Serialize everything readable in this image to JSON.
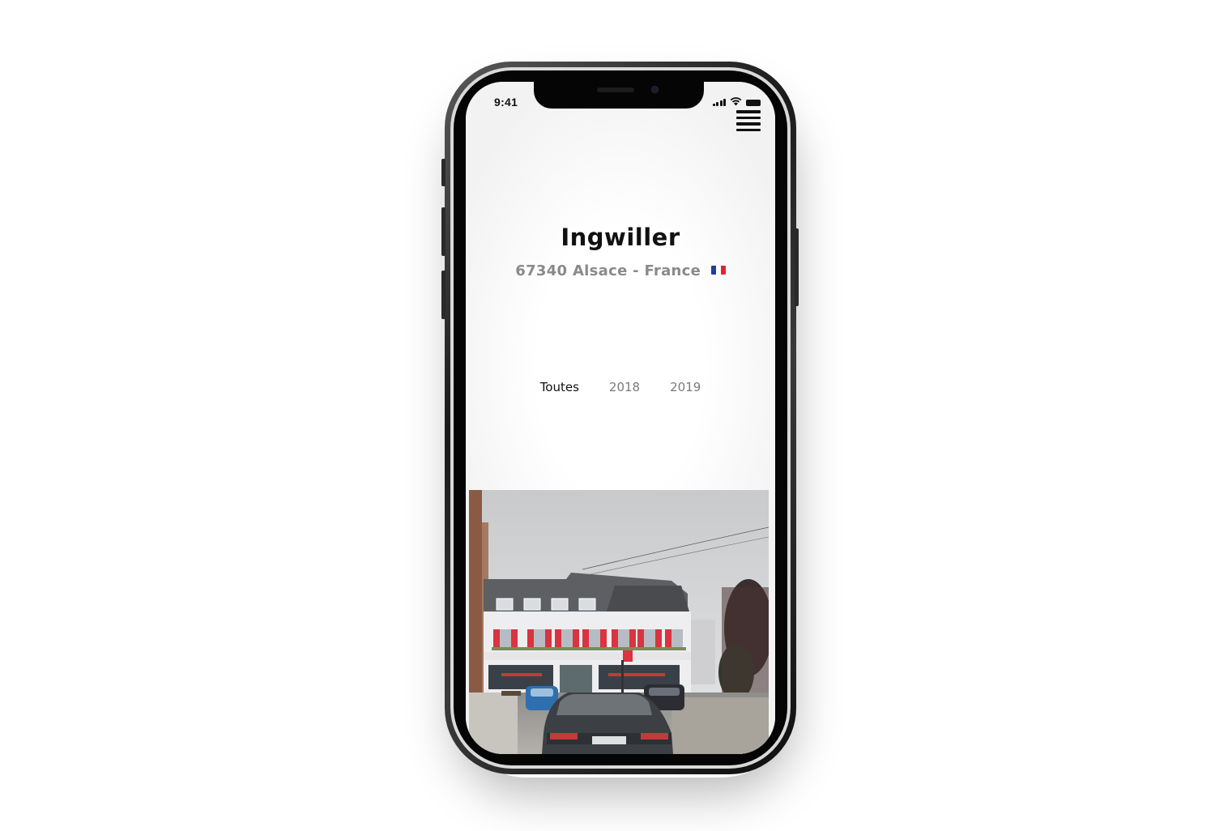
{
  "status_bar": {
    "time": "9:41"
  },
  "menu": {
    "icon": "hamburger-menu-icon"
  },
  "location": {
    "city": "Ingwiller",
    "region_line": "67340 Alsace - France",
    "flag_icon": "france-flag-icon",
    "flag_colors": [
      "#1f3f9a",
      "#ffffff",
      "#e0252f"
    ]
  },
  "filters": {
    "tabs": [
      {
        "label": "Toutes",
        "active": true
      },
      {
        "label": "2018",
        "active": false
      },
      {
        "label": "2019",
        "active": false
      }
    ]
  },
  "photo": {
    "subject": "street-photo"
  },
  "colors": {
    "title": "#111111",
    "subtitle": "#8a8a8a",
    "tab_inactive": "#7a7a7a",
    "shutters": "#d9343f"
  }
}
